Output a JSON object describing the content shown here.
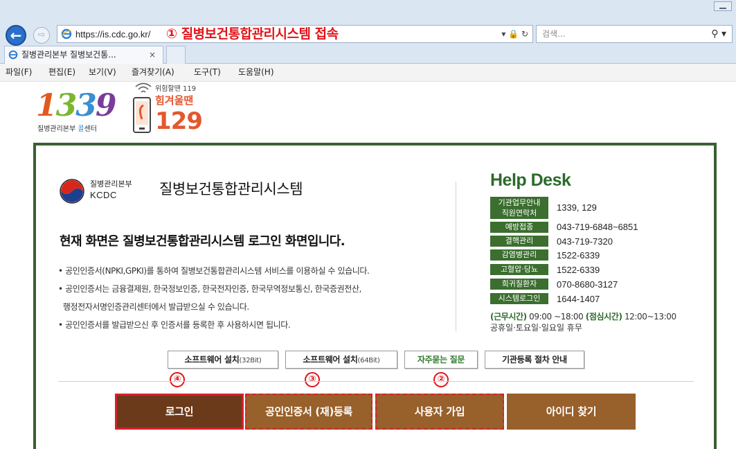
{
  "browser": {
    "url": "https://is.cdc.go.kr/",
    "annotation": "① 질병보건통합관리시스템 접속",
    "url_tools": "▾ 🔒 ↻",
    "search_placeholder": "검색...",
    "search_icon": "search-icon",
    "tab_title": "질병관리본부 질병보건통...",
    "tab_close": "×",
    "menu": [
      "파일(F)",
      "편집(E)",
      "보기(V)",
      "즐겨찾기(A)",
      "도구(T)",
      "도움말(H)"
    ]
  },
  "header": {
    "logo_digits": [
      "1",
      "3",
      "3",
      "9"
    ],
    "logo_sub_a": "질병관리본부 ",
    "logo_sub_b": "콜",
    "logo_sub_c": "센터",
    "hotline_small": "위험할땐 119",
    "hotline_label": "힘겨울땐",
    "hotline_number": "129"
  },
  "login": {
    "org_korean": "질병관리본부",
    "org_english": "KCDC",
    "system_title": "질병보건통합관리시스템",
    "notice": "현재 화면은 질병보건통합관리시스템 로그인 화면입니다.",
    "bullets": [
      "• 공인인증서(NPKI,GPKI)를 통하여 질병보건통합관리시스템 서비스를 이용하실 수 있습니다.",
      "• 공인인증서는 금융결제원, 한국정보인증, 한국전자인증, 한국무역정보통신, 한국증권전산,",
      "  행정전자서명인증관리센터에서 발급받으실 수 있습니다.",
      "• 공인인증서를 발급받으신 후 인증서를 등록한 후 사용하시면 됩니다."
    ]
  },
  "helpdesk": {
    "title": "Help Desk",
    "rows": [
      {
        "tag": "기관업무안내",
        "tag2": "직원연락처",
        "value": "1339, 129"
      },
      {
        "tag": "예방접종",
        "value": "043-719-6848~6851"
      },
      {
        "tag": "결핵관리",
        "value": "043-719-7320"
      },
      {
        "tag": "감염병관리",
        "value": "1522-6339"
      },
      {
        "tag": "고혈압·당뇨",
        "value": "1522-6339"
      },
      {
        "tag": "희귀질환자",
        "value": "070-8680-3127"
      },
      {
        "tag": "시스템로그인",
        "value": "1644-1407"
      }
    ],
    "hours_label": "(근무시간)",
    "hours_value": " 09:00 ~18:00 ",
    "lunch_label": "(점심시간)",
    "lunch_value": " 12:00~13:00",
    "holidays": "공휴일·토요일·일요일 휴무"
  },
  "buttons": {
    "sw32_label": "소프트웨어 설치",
    "sw32_sub": "(32Bit)",
    "sw64_label": "소프트웨어 설치",
    "sw64_sub": "(64Bit)",
    "faq": "자주묻는 질문",
    "org_reg": "기관등록 절차 안내",
    "login": "로그인",
    "cert": "공인인증서 (재)등록",
    "join": "사용자 가입",
    "find_id": "아이디 찾기"
  },
  "markers": {
    "m4": "④",
    "m3": "③",
    "m2": "②"
  },
  "colors": {
    "accent_green": "#3b6e2f",
    "brown": "#98602b",
    "dark_brown": "#6b3a1a",
    "annotation_red": "#e0141a"
  }
}
